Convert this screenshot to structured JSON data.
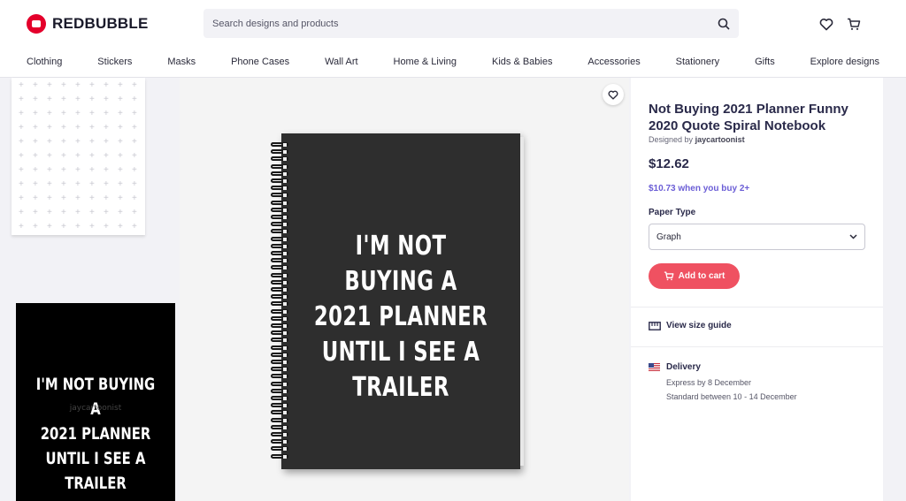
{
  "brand": {
    "name": "REDBUBBLE"
  },
  "search": {
    "placeholder": "Search designs and products"
  },
  "nav": {
    "items": [
      "Clothing",
      "Stickers",
      "Masks",
      "Phone Cases",
      "Wall Art",
      "Home & Living",
      "Kids & Babies",
      "Accessories",
      "Stationery",
      "Gifts",
      "Explore designs"
    ]
  },
  "product_image": {
    "lines": [
      "I'M NOT BUYING A",
      "2021 PLANNER",
      "UNTIL I SEE A TRAILER"
    ],
    "watermark": "jaycartoonist"
  },
  "product": {
    "title": "Not Buying 2021 Planner Funny 2020 Quote Spiral Notebook",
    "designed_by_label": "Designed by",
    "designer": "jaycartoonist",
    "price": "$12.62",
    "bulk_price": "$10.73 when you buy 2+",
    "paper_type_label": "Paper Type",
    "paper_type_value": "Graph",
    "add_to_cart": "Add to cart",
    "size_guide": "View size guide",
    "delivery_label": "Delivery",
    "express": "Express by 8 December",
    "standard": "Standard between 10 - 14 December"
  },
  "colors": {
    "brand_red": "#e4002b",
    "cart_button": "#ef5161",
    "bulk_price_text": "#6b5ed6"
  }
}
